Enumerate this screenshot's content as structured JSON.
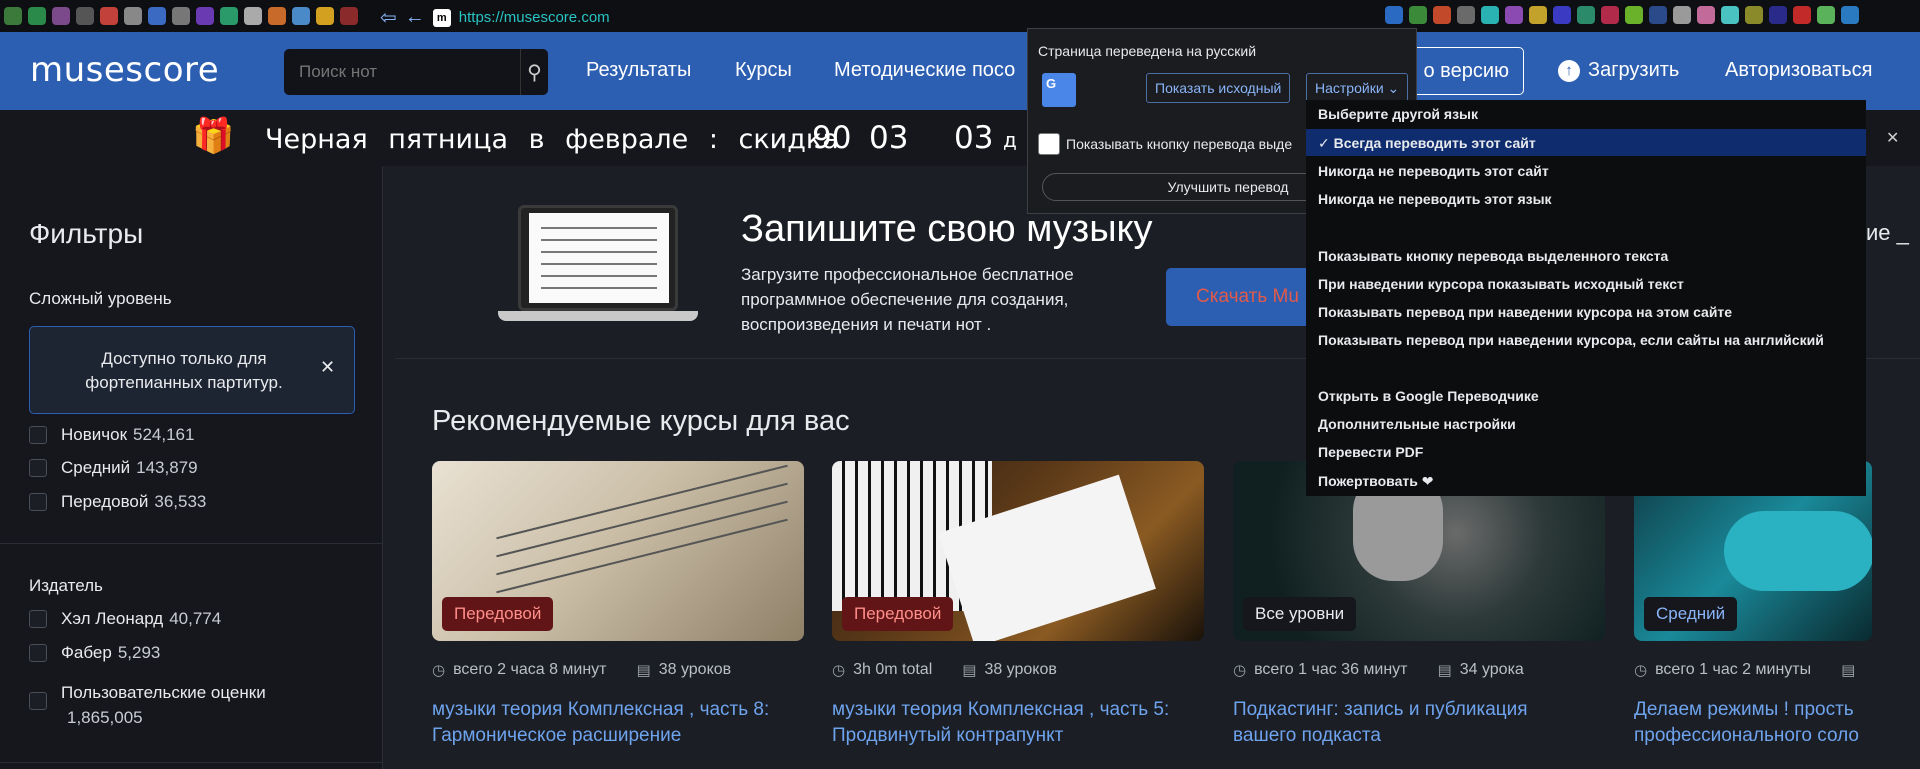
{
  "browser": {
    "url": "https://musescore.com",
    "site_icon_text": "m",
    "favicons": [
      "#3c7a3c",
      "#2a8a4a",
      "#7a4a8a",
      "#555",
      "#c2413a",
      "#888",
      "#3a6ac2",
      "#777",
      "#6a3ab2",
      "#2a9a6a",
      "#aaa",
      "#c86a2a",
      "#4a8ac8",
      "#d4a020",
      "#8a2a2a",
      "#3ab2a2",
      "#5a5a9a",
      "#b2b23a",
      "#2a5a8a",
      "#9a3a6a"
    ],
    "right_favicons": [
      "#2a6ac2",
      "#3a8a3a",
      "#c24a2a",
      "#6a6a6a",
      "#2ab2b2",
      "#8a4ab2",
      "#c2a22a",
      "#3a3ac2",
      "#2a8a6a",
      "#b22a4a",
      "#6ab22a",
      "#2a4a8a",
      "#9a9a9a",
      "#c26a9a",
      "#4ac2c2",
      "#8a8a2a",
      "#2a2a8a",
      "#c22a2a",
      "#5ab25a",
      "#2a7ac2"
    ]
  },
  "header": {
    "logo": "musescore",
    "search_placeholder": "Поиск нот",
    "nav": [
      "Результаты",
      "Курсы",
      "Методические посо"
    ],
    "pro_label": "о версию",
    "upload_label": "Загрузить",
    "login_label": "Авторизоваться"
  },
  "promo": {
    "text": "Черная пятница в феврале : скидка",
    "n1": "90",
    "n2": "03",
    "n3": "03",
    "n4": "д"
  },
  "sidebar": {
    "title": "Фильтры",
    "level_label": "Сложный уровень",
    "note": "Доступно только для фортепианных партитур.",
    "levels": [
      {
        "label": "Новичок",
        "count": "524,161"
      },
      {
        "label": "Средний",
        "count": "143,879"
      },
      {
        "label": "Передовой",
        "count": "36,533"
      }
    ],
    "publisher_label": "Издатель",
    "publishers": [
      {
        "label": "Хэл Леонард",
        "count": "40,774"
      },
      {
        "label": "Фабер",
        "count": "5,293"
      },
      {
        "label": "Пользовательские оценки",
        "count": "1,865,005"
      }
    ]
  },
  "hero": {
    "title": "Запишите свою музыку",
    "subtitle": "Загрузите профессиональное бесплатное программное обеспечение для создания, воспроизведения и печати нот .",
    "download_label": "Скачать Mu",
    "right_text": "ие _"
  },
  "courses": {
    "title": "Рекомендуемые курсы для вас",
    "items": [
      {
        "badge": "Передовой",
        "duration": "всего 2 часа 8 минут",
        "lessons": "38 уроков",
        "title": "музыки теория Комплексная , часть 8: Гармоническое расширение"
      },
      {
        "badge": "Передовой",
        "duration": "3h 0m total",
        "lessons": "38 уроков",
        "title": "музыки теория Комплексная , часть 5: Продвинутый контрапункт"
      },
      {
        "badge": "Все уровни",
        "duration": "всего 1 час 36 минут",
        "lessons": "34 урока",
        "title": "Подкастинг: запись и публикация вашего подкаста"
      },
      {
        "badge": "Средний",
        "duration": "всего 1 час 2 минуты",
        "lessons": "",
        "title": "Делаем режимы ! прость профессионального соло"
      }
    ]
  },
  "translate": {
    "title": "Страница переведена на русский",
    "logo_text": "G",
    "show_original": "Показать исходный",
    "settings": "Настройки",
    "checkbox_label": "Показывать кнопку перевода выде",
    "improve": "Улучшить перевод",
    "menu": [
      "Выберите другой язык",
      "✓ Всегда переводить этот сайт",
      "Никогда не переводить этот сайт",
      "Никогда не переводить этот язык",
      "Показывать кнопку перевода выделенного текста",
      "При наведении курсора показывать исходный текст",
      "Показывать перевод при наведении курсора на этом сайте",
      "Показывать перевод при наведении курсора, если сайты на английский",
      "Открыть в Google Переводчике",
      "Дополнительные настройки",
      "Перевести PDF",
      "Пожертвовать ❤"
    ]
  }
}
